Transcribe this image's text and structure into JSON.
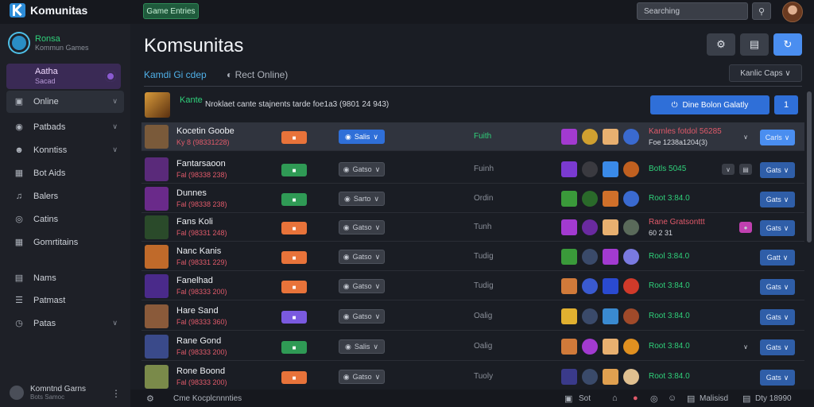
{
  "app": {
    "name": "Komunitas"
  },
  "topbar": {
    "chip_label": "Game Entries",
    "search_placeholder": "Searching",
    "search_icon": "search-icon"
  },
  "sidebar": {
    "profile": {
      "name": "Ronsa",
      "subtitle": "Kommun Games"
    },
    "selected_card": {
      "title": "Aatha",
      "subtitle": "Sacad"
    },
    "items": [
      {
        "label": "Online",
        "icon": "monitor-icon",
        "has_chevron": true,
        "active": true
      },
      {
        "label": "Patbads",
        "icon": "compass-icon",
        "has_chevron": true
      },
      {
        "label": "Konntiss",
        "icon": "people-icon",
        "has_chevron": true
      },
      {
        "label": "Bot Aids",
        "icon": "bot-icon"
      },
      {
        "label": "Balers",
        "icon": "music-icon"
      },
      {
        "label": "Catins",
        "icon": "coin-icon"
      },
      {
        "label": "Gomrtitains",
        "icon": "grid-icon"
      },
      {
        "label": "Nams",
        "icon": "image-icon"
      },
      {
        "label": "Patmast",
        "icon": "list-icon"
      },
      {
        "label": "Patas",
        "icon": "clock-icon",
        "has_chevron": true
      }
    ],
    "footer": {
      "title": "Komntnd Garns",
      "subtitle": "Bots Samoc"
    }
  },
  "main": {
    "title": "Komsunitas",
    "tabs": [
      {
        "label": "Kamdi Gi cdep"
      },
      {
        "label": "Rect Online)"
      }
    ],
    "filter_label": "Kanlic Caps",
    "featured": {
      "name": "Kante",
      "description": "Nroklaet cante stajnents tarde foe1a3 (9801 24 943)",
      "primary_label": "Dine  Bolon Galatly",
      "square_label": "1"
    },
    "rows": [
      {
        "name": "Kocetin Goobe",
        "stat": "Ky 8 (98331228)",
        "pill_color": "#e8733a",
        "select": "Salis",
        "select_blue": true,
        "status": "Fuith",
        "status_green": true,
        "rank_top": "Karnles fotdol 56285",
        "rank_sub": "Foe 1238a1204(3)",
        "action": "Carls",
        "action_light": true,
        "avatar_color": "#7a5a3a",
        "icon_colors": [
          "#a23ad0",
          "#d0a030",
          "#e8b070",
          "#3a6ad0"
        ]
      },
      {
        "name": "Fantarsaoon",
        "stat": "Fal (98338 238)",
        "pill_color": "#2f9a55",
        "select": "Gatso",
        "status": "Fuinh",
        "rank_text": "Botls 5045",
        "action": "Gats",
        "avatar_color": "#5a2a7a",
        "icon_colors": [
          "#7a3ad0",
          "#3a3a40",
          "#3a8ae8",
          "#c06020"
        ]
      },
      {
        "name": "Dunnes",
        "stat": "Fal (98338 238)",
        "pill_color": "#2f9a55",
        "select": "Sarto",
        "status": "Ordin",
        "rank_text": "Root 3:84.0",
        "action": "Gats",
        "avatar_color": "#6a2a8a",
        "icon_colors": [
          "#3a9a3a",
          "#2a6a2a",
          "#d0702a",
          "#3a6ad0"
        ]
      },
      {
        "name": "Fans Koli",
        "stat": "Fal (98331 248)",
        "pill_color": "#e8733a",
        "select": "Gatso",
        "status": "Tunh",
        "rank_top": "Rane Gratsonttt",
        "rank_sub": "60  2 31",
        "action": "Gats",
        "avatar_color": "#2a4a2a",
        "icon_colors": [
          "#a23ad0",
          "#6a2aa0",
          "#e8b070",
          "#5a6a5a"
        ]
      },
      {
        "name": "Nanc Kanis",
        "stat": "Fal (98331 229)",
        "pill_color": "#e8733a",
        "select": "Gatso",
        "status": "Tudig",
        "rank_text": "Rool 3:84.0",
        "action": "Gatt",
        "avatar_color": "#c06a2a",
        "icon_colors": [
          "#3a9a3a",
          "#3a4a6a",
          "#a23ad0",
          "#7a7ae0"
        ]
      },
      {
        "name": "Fanelhad",
        "stat": "Fal (98333 200)",
        "pill_color": "#e8733a",
        "select": "Gatso",
        "status": "Tudig",
        "rank_text": "Root 3:84.0",
        "action": "Gats",
        "avatar_color": "#4a2a8a",
        "icon_colors": [
          "#d07a3a",
          "#3a5ad0",
          "#2a4ad0",
          "#d03a2a"
        ]
      },
      {
        "name": "Hare Sand",
        "stat": "Fal (98333 360)",
        "pill_color": "#7a5ae0",
        "select": "Gatso",
        "status": "Oalig",
        "rank_text": "Root 3:84.0",
        "action": "Gats",
        "avatar_color": "#8a5a3a",
        "icon_colors": [
          "#e0b030",
          "#3a4a6a",
          "#3a8ad0",
          "#a04a2a"
        ]
      },
      {
        "name": "Rane Gond",
        "stat": "Fal (98333 200)",
        "pill_color": "#2f9a55",
        "select": "Salis",
        "status": "Oalig",
        "rank_text": "Root 3:84.0",
        "action": "Gats",
        "avatar_color": "#3a4a8a",
        "icon_colors": [
          "#d07a3a",
          "#a23ad0",
          "#e8b070",
          "#e09020"
        ]
      },
      {
        "name": "Rone Boond",
        "stat": "Fal (98333 200)",
        "pill_color": "#e8733a",
        "select": "Gatso",
        "status": "Tuoly",
        "rank_text": "Root 3:84.0",
        "action": "Gats",
        "avatar_color": "#7a8a4a",
        "icon_colors": [
          "#3a3a8a",
          "#3a4a6a",
          "#e0a050",
          "#e0c090"
        ]
      }
    ]
  },
  "bottombar": {
    "label": "Cme  Kocplcnnnties",
    "link_a": "Sot",
    "link_b": "Malisisd",
    "link_c": "Dty 18990"
  }
}
